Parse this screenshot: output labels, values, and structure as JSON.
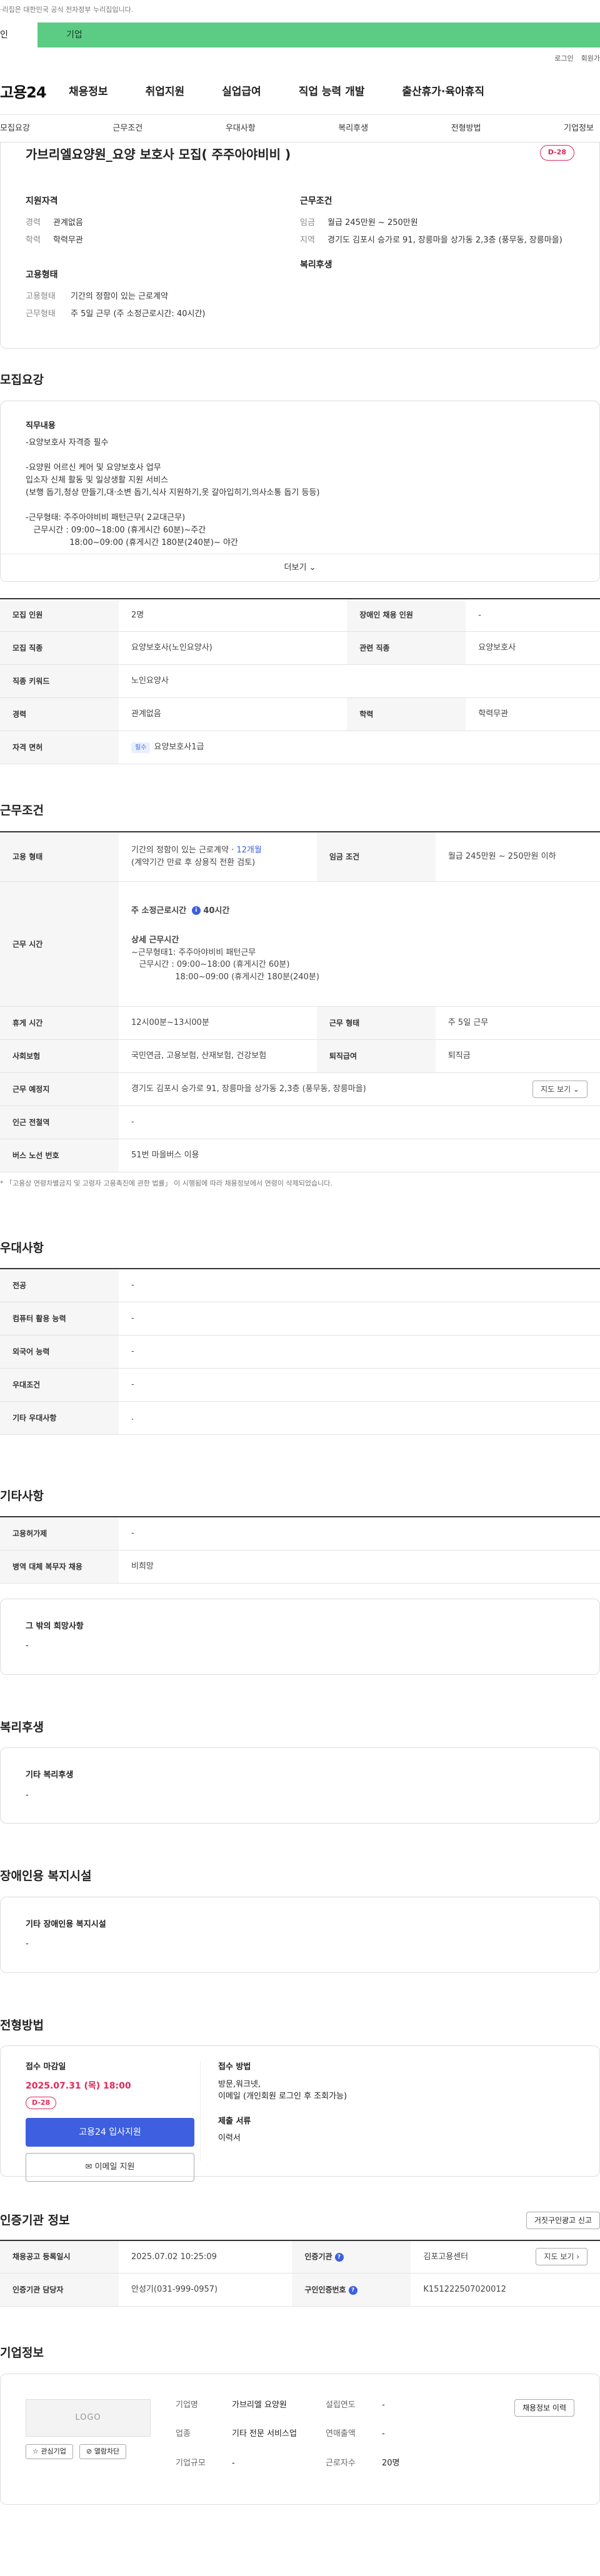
{
  "notice": "·리집은 대한민국 공식 전자정부 누리집입니다.",
  "top_tabs": {
    "personal": "인",
    "company": "기업"
  },
  "util": {
    "login": "로그인",
    "signup": "회원가"
  },
  "logo": "고용24",
  "main_nav": [
    "채용정보",
    "취업지원",
    "실업급여",
    "직업 능력 개발",
    "출산휴가·육아휴직"
  ],
  "sub_nav": [
    "모집요강",
    "근무조건",
    "우대사항",
    "복리후생",
    "전형방법",
    "기업정보"
  ],
  "job": {
    "title": "가브리엘요양원_요양 보호사 모집( 주주아야비비 )",
    "dday": "D-28",
    "qual_head": "지원자격",
    "career_k": "경력",
    "career_v": "관계없음",
    "edu_k": "학력",
    "edu_v": "학력무관",
    "emp_head": "고용형태",
    "emptype_k": "고용형태",
    "emptype_v": "기간의 정함이 있는 근로계약",
    "workform_k": "근무형태",
    "workform_v": "주 5일 근무 (주 소정근로시간: 40시간)",
    "cond_head": "근무조건",
    "wage_k": "임금",
    "wage_v": "월급 245만원 ~ 250만원",
    "region_k": "지역",
    "region_v": "경기도 김포시 승가로 91, 장릉마을 상가동 2,3층 (풍무동, 장릉마을)",
    "welfare_head": "복리후생"
  },
  "recruit": {
    "title": "모집요강",
    "desc_head": "직무내용",
    "desc_lines": [
      "-요양보호사 자격증 필수",
      "",
      "-요양원 어르신 케어 및 요양보호사 업무",
      "입소자 신체 활동 및 일상생활 지원 서비스",
      "(보행 돕기,청상 만들기,대·소변 돕기,식사 지원하기,옷 갈아입히기,의사소통 돕기 등등)",
      "",
      "-근무형태: 주주아야비비 패턴근무( 2교대근무)",
      "   근무시간 : 09:00~18:00 (휴게시간 60분)~주간",
      "                 18:00~09:00 (휴게시간 180분(240분)~ 야간"
    ],
    "more": "더보기 ⌄",
    "rows": [
      {
        "k1": "모집 인원",
        "v1": "2명",
        "k2": "장애인 채용 인원",
        "v2": "-"
      },
      {
        "k1": "모집 직종",
        "v1": "요양보호사(노인요양사)",
        "k2": "관련 직종",
        "v2": "요양보호사"
      },
      {
        "k1": "직종 키워드",
        "v1": "노인요양사"
      },
      {
        "k1": "경력",
        "v1": "관계없음",
        "k2": "학력",
        "v2": "학력무관"
      },
      {
        "k1": "자격 면허",
        "pill": "필수",
        "v1": "요양보호사1급"
      }
    ]
  },
  "cond": {
    "title": "근무조건",
    "emp_k": "고용 형태",
    "emp_v1": "기간의 정함이 있는 근로계약 · ",
    "emp_v1b": "12개월",
    "emp_v2": "(계약기간 만료 후 상용직 전환 검토)",
    "wage_k": "임금 조건",
    "wage_v": "월급 245만원 ~ 250만원 이하",
    "time_k": "근무 시간",
    "time_head": "주 소정근로시간",
    "time_val": "40시간",
    "time_detail_head": "상세 근무시간",
    "time_lines": [
      "~근무형태1: 주주아야비비 패턴근무",
      "   근무시간 : 09:00~18:00 (휴게시간 60분)",
      "                 18:00~09:00 (휴게시간 180분(240분)"
    ],
    "break_k": "휴게 시간",
    "break_v": "12시00분~13시00분",
    "form_k": "근무 형태",
    "form_v": "주 5일 근무",
    "ins_k": "사회보험",
    "ins_v": "국민연금, 고용보험, 산재보험, 건강보험",
    "ret_k": "퇴직급여",
    "ret_v": "퇴직금",
    "place_k": "근무 예정지",
    "place_v": "경기도 김포시 승가로 91, 장릉마을 상가동 2,3층 (풍무동, 장릉마을)",
    "map_btn": "지도 보기 ⌄",
    "sub_k": "인근 전철역",
    "sub_v": "-",
    "bus_k": "버스 노선 번호",
    "bus_v": "51번 마을버스 이용",
    "note": "* 「고용상 연령차별금지 및 고령자 고용촉진에 관한 법률」 이 시행됨에 따라 채용정보에서 연령이 삭제되었습니다."
  },
  "pref": {
    "title": "우대사항",
    "rows": [
      {
        "k": "전공",
        "v": "-"
      },
      {
        "k": "컴퓨터 활용 능력",
        "v": "-"
      },
      {
        "k": "외국어 능력",
        "v": "-"
      },
      {
        "k": "우대조건",
        "v": "-"
      },
      {
        "k": "기타 우대사항",
        "v": "."
      }
    ]
  },
  "etc": {
    "title": "기타사항",
    "rows": [
      {
        "k": "고용허가제",
        "v": "-"
      },
      {
        "k": "병역 대체 복무자 채용",
        "v": "비희망"
      }
    ],
    "box_head": "그 밖의 희망사항",
    "box_v": "-"
  },
  "welfare": {
    "title": "복리후생",
    "box_head": "기타 복리후생",
    "box_v": "-"
  },
  "disabled": {
    "title": "장애인용 복지시설",
    "box_head": "기타 장애인용 복지시설",
    "box_v": "-"
  },
  "screen": {
    "title": "전형방법",
    "deadline_label": "접수 마감일",
    "deadline": "2025.07.31 (목) 18:00",
    "dday": "D-28",
    "apply_btn": "고용24 입사지원",
    "mail_btn": "✉ 이메일 지원",
    "method_label": "접수 방법",
    "method_v1": "방문,워크넷,",
    "method_v2": "이메일 (개인회원 로그인 후 조회가능)",
    "doc_label": "제출 서류",
    "doc_v": "이력서"
  },
  "cert": {
    "title": "인증기관 정보",
    "report_btn": "거짓구인광고 신고",
    "reg_k": "채용공고 등록일시",
    "reg_v": "2025.07.02 10:25:09",
    "org_k": "인증기관",
    "org_v": "김포고용센터",
    "map_btn": "지도 보기 ›",
    "mgr_k": "인증기관 담당자",
    "mgr_v": "안성기(031-999-0957)",
    "no_k": "구인인증번호",
    "no_v": "K151222507020012"
  },
  "company": {
    "title": "기업정보",
    "logo": "LOGO",
    "fav_btn": "☆ 관심기업",
    "block_btn": "⊘ 열람차단",
    "name_k": "기업명",
    "name_v": "가브리엘 요양원",
    "est_k": "설립연도",
    "est_v": "-",
    "ind_k": "업종",
    "ind_v": "기타 전문 서비스업",
    "sales_k": "연매출액",
    "sales_v": "-",
    "emp_k": "근로자수",
    "emp_v": "20명",
    "size_k": "기업규모",
    "size_v": "-",
    "history_btn": "채용정보 이력"
  }
}
